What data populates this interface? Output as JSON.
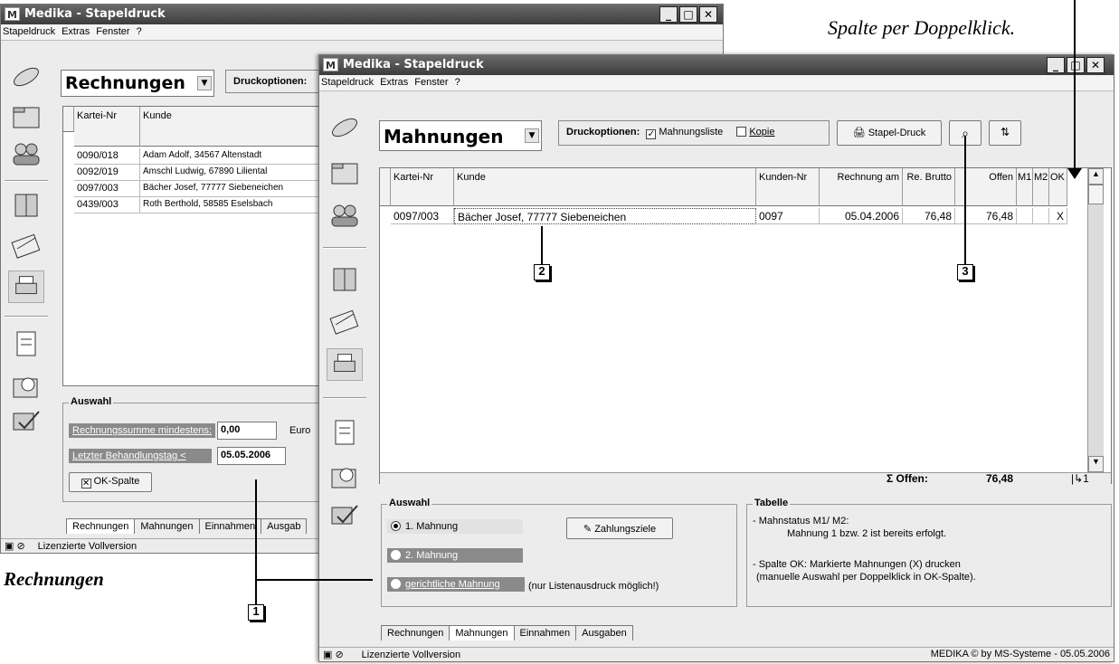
{
  "annotation": {
    "top_caption": "Spalte per Doppelklick.",
    "left_caption": "Rechnungen",
    "callouts": [
      "1",
      "2",
      "3"
    ]
  },
  "back_window": {
    "title": "Medika - Stapeldruck",
    "menu": [
      "Stapeldruck",
      "Extras",
      "Fenster",
      "?"
    ],
    "combo_value": "Rechnungen",
    "druckoptionen_label": "Druckoptionen:",
    "columns": [
      "Kartei-Nr",
      "Kunde"
    ],
    "rows": [
      [
        "0090/018",
        "Adam Adolf, 34567 Altenstadt"
      ],
      [
        "0092/019",
        "Amschl Ludwig, 67890 Liliental"
      ],
      [
        "0097/003",
        "Bächer Josef, 77777 Siebeneichen"
      ],
      [
        "0439/003",
        "Roth Berthold, 58585 Eselsbach"
      ]
    ],
    "auswahl_title": "Auswahl",
    "rechnungssumme_label": "Rechnungssumme mindestens:",
    "rechnungssumme_value": "0,00",
    "currency": "Euro",
    "letzter_label": "Letzter Behandlungstag  <",
    "letzter_value": "05.05.2006",
    "ok_spalte_label": "OK-Spalte",
    "tabs": [
      "Rechnungen",
      "Mahnungen",
      "Einnahmen",
      "Ausgab"
    ],
    "status": "Lizenzierte Vollversion"
  },
  "front_window": {
    "title": "Medika - Stapeldruck",
    "menu": [
      "Stapeldruck",
      "Extras",
      "Fenster",
      "?"
    ],
    "combo_value": "Mahnungen",
    "druckoptionen_label": "Druckoptionen:",
    "mahnungsliste_label": "Mahnungsliste",
    "mahnungsliste_checked": true,
    "kopie_label": "Kopie",
    "kopie_checked": false,
    "stapel_druck_label": "Stapel-Druck",
    "columns": [
      "Kartei-Nr",
      "Kunde",
      "Kunden-Nr",
      "Rechnung am",
      "Re. Brutto",
      "Offen",
      "M1",
      "M2",
      "OK"
    ],
    "rows": [
      [
        "0097/003",
        "Bächer Josef, 77777 Siebeneichen",
        "0097",
        "05.04.2006",
        "76,48",
        "76,48",
        "",
        "",
        "X"
      ]
    ],
    "sum_label": "Σ Offen:",
    "sum_value": "76,48",
    "sum_count": "|↳1",
    "auswahl_title": "Auswahl",
    "radio1": "1. Mahnung",
    "radio2": "2. Mahnung",
    "radio3": "gerichtliche Mahnung",
    "radio3_note": "(nur Listenausdruck möglich!)",
    "zahlungsziele_label": "Zahlungsziele",
    "tabelle_title": "Tabelle",
    "tabelle_line1": "- Mahnstatus M1/ M2:",
    "tabelle_line2": "Mahnung 1 bzw. 2 ist bereits erfolgt.",
    "tabelle_line3": "- Spalte OK: Markierte Mahnungen (X) drucken",
    "tabelle_line4": "(manuelle Auswahl per Doppelklick in OK-Spalte).",
    "tabs": [
      "Rechnungen",
      "Mahnungen",
      "Einnahmen",
      "Ausgaben"
    ],
    "status_left": "Lizenzierte Vollversion",
    "status_right": "MEDIKA © by MS-Systeme  -  05.05.2006"
  }
}
